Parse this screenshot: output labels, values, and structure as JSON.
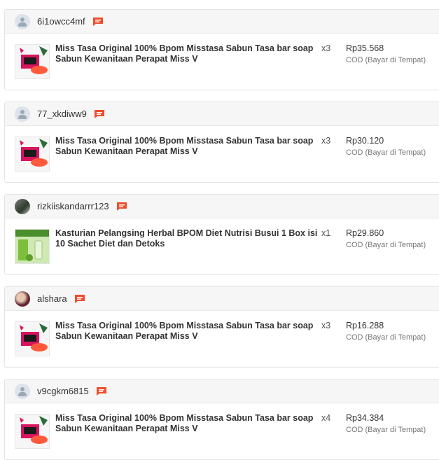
{
  "orders": [
    {
      "username": "6i1owcc4mf",
      "avatar": "default-avatar",
      "product": "Miss Tasa Original 100% Bpom Misstasa Sabun Tasa bar soap Sabun Kewanitaan Perapat Miss V",
      "qty": "x3",
      "price": "Rp35.568",
      "payment": "COD (Bayar di Tempat)",
      "thumb": "soap-product"
    },
    {
      "username": "77_xkdiww9",
      "avatar": "default-avatar",
      "product": "Miss Tasa Original 100% Bpom Misstasa Sabun Tasa bar soap Sabun Kewanitaan Perapat Miss V",
      "qty": "x3",
      "price": "Rp30.120",
      "payment": "COD (Bayar di Tempat)",
      "thumb": "soap-product"
    },
    {
      "username": "rizkiiskandarrr123",
      "avatar": "photo-avatar",
      "product": "Kasturian Pelangsing Herbal BPOM Diet Nutrisi Busui 1 Box isi 10 Sachet Diet dan Detoks",
      "qty": "x1",
      "price": "Rp29.860",
      "payment": "COD (Bayar di Tempat)",
      "thumb": "herbal-drink-product"
    },
    {
      "username": "alshara",
      "avatar": "photo-avatar",
      "product": "Miss Tasa Original 100% Bpom Misstasa Sabun Tasa bar soap Sabun Kewanitaan Perapat Miss V",
      "qty": "x3",
      "price": "Rp16.288",
      "payment": "COD (Bayar di Tempat)",
      "thumb": "soap-product"
    },
    {
      "username": "v9cgkm6815",
      "avatar": "default-avatar",
      "product": "Miss Tasa Original 100% Bpom Misstasa Sabun Tasa bar soap Sabun Kewanitaan Perapat Miss V",
      "qty": "x4",
      "price": "Rp34.384",
      "payment": "COD (Bayar di Tempat)",
      "thumb": "soap-product"
    }
  ],
  "colors": {
    "chat_icon": "#ee4d2d",
    "header_bg": "#f6f6f6",
    "border": "#e3e3e3"
  }
}
